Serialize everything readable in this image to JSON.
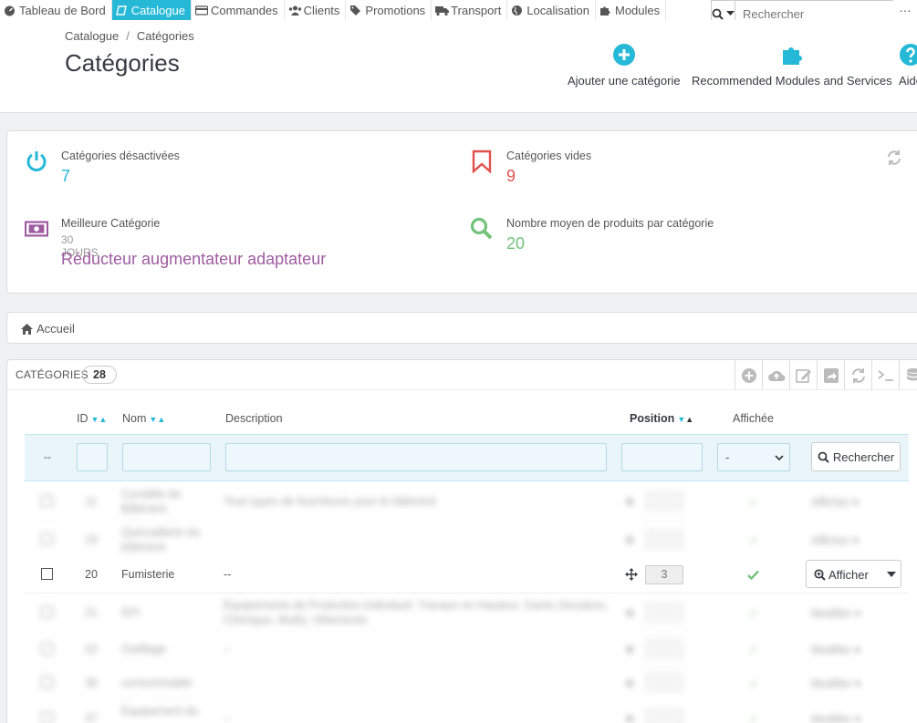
{
  "nav": {
    "items": [
      {
        "label": "Tableau de Bord",
        "icon": "dashboard-icon",
        "active": false
      },
      {
        "label": "Catalogue",
        "icon": "book-icon",
        "active": true
      },
      {
        "label": "Commandes",
        "icon": "credit-card-icon",
        "active": false
      },
      {
        "label": "Clients",
        "icon": "users-icon",
        "active": false
      },
      {
        "label": "Promotions",
        "icon": "tag-icon",
        "active": false
      },
      {
        "label": "Transport",
        "icon": "truck-icon",
        "active": false
      },
      {
        "label": "Localisation",
        "icon": "globe-icon",
        "active": false
      },
      {
        "label": "Modules",
        "icon": "puzzle-icon",
        "active": false
      }
    ],
    "search_placeholder": "Rechercher"
  },
  "header": {
    "breadcrumb": [
      "Catalogue",
      "Catégories"
    ],
    "breadcrumb_sep": "/",
    "title": "Catégories",
    "toolbar": [
      {
        "label": "Ajouter une catégorie",
        "icon": "plus-circle-icon"
      },
      {
        "label": "Recommended Modules and Services",
        "icon": "puzzle-icon"
      },
      {
        "label": "Aide",
        "icon": "help-icon"
      }
    ]
  },
  "kpis": [
    {
      "label": "Catégories désactivées",
      "value": "7",
      "color": "#25b9d7",
      "icon": "power-icon"
    },
    {
      "label": "Catégories vides",
      "value": "9",
      "color": "#e0524e",
      "icon": "bookmark-icon"
    },
    {
      "label": "Meilleure Catégorie",
      "sub": "30 JOURS",
      "value": "Réducteur augmentateur adaptateur",
      "color": "#9e5ba1",
      "icon": "money-icon"
    },
    {
      "label": "Nombre moyen de produits par catégorie",
      "value": "20",
      "color": "#72c279",
      "icon": "search-icon"
    }
  ],
  "home_breadcrumb": "Accueil",
  "list": {
    "title": "Catégories",
    "count": "28",
    "columns": {
      "id": "ID",
      "name": "Nom",
      "description": "Description",
      "position": "Position",
      "displayed": "Affichée"
    },
    "filter": {
      "dash": "--",
      "select_value": "-",
      "search_label": "Rechercher"
    },
    "rows": [
      {
        "id": "",
        "name": "",
        "description": "",
        "position": "",
        "blurred": true
      },
      {
        "id": "",
        "name": "",
        "description": "",
        "position": "",
        "blurred": true
      },
      {
        "id": "20",
        "name": "Fumisterie",
        "description": "--",
        "position": "3",
        "action": "Afficher",
        "blurred": false
      },
      {
        "id": "",
        "name": "",
        "description": "",
        "position": "",
        "blurred": true
      },
      {
        "id": "",
        "name": "",
        "description": "",
        "position": "",
        "blurred": true
      },
      {
        "id": "",
        "name": "",
        "description": "",
        "position": "",
        "blurred": true
      },
      {
        "id": "",
        "name": "",
        "description": "",
        "position": "",
        "blurred": true
      }
    ]
  },
  "colors": {
    "accent": "#25b9d7",
    "success": "#72c279",
    "danger": "#e0524e",
    "purple": "#9e5ba1"
  }
}
